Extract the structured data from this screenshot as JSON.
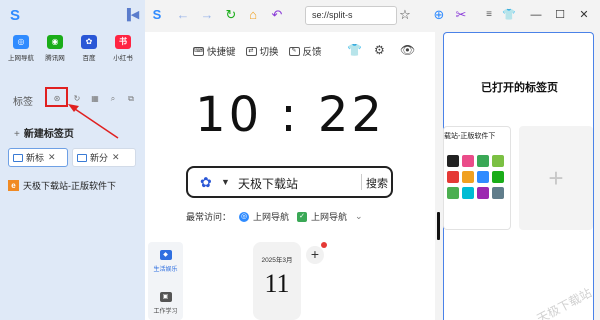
{
  "sidebar": {
    "quick_links": [
      {
        "label": "上网导航",
        "icon": "shield-nav-icon",
        "color": "#2f8bff",
        "glyph": "◎"
      },
      {
        "label": "腾讯网",
        "icon": "tencent-icon",
        "color": "#1aad19",
        "glyph": "◉"
      },
      {
        "label": "百度",
        "icon": "baidu-paw-icon",
        "color": "#2a57d6",
        "glyph": "✿"
      },
      {
        "label": "小红书",
        "icon": "xiaohongshu-icon",
        "color": "#ff2442",
        "glyph": "书"
      }
    ],
    "bookmarks_title": "标签",
    "new_tab_group": "新建标签页",
    "tabs": [
      {
        "label": "新标",
        "close": "✕"
      },
      {
        "label": "新分",
        "close": "✕"
      }
    ],
    "open_tab": {
      "favicon": "e",
      "label": "天极下载站-正版软件下"
    }
  },
  "toolbar": {
    "address": "se://split-s",
    "accent": "#2f8bff"
  },
  "main": {
    "links": [
      {
        "icon": "keyboard-icon",
        "label": "快捷键"
      },
      {
        "icon": "switch-icon",
        "label": "切换"
      },
      {
        "icon": "feedback-icon",
        "label": "反馈"
      }
    ],
    "clock": "10 : 22",
    "search": {
      "engine_text": "天极下载站",
      "button": "搜索"
    },
    "frequent": {
      "label": "最常访问：",
      "items": [
        "上网导航",
        "上网导航"
      ]
    },
    "categories": [
      {
        "label": "生活娱乐",
        "color": "#2f6fe0"
      },
      {
        "label": "工作学习",
        "color": "#555555"
      }
    ],
    "calendar": {
      "date": "2025年3月",
      "day": "11"
    }
  },
  "split_panel": {
    "title": "已打开的标签页",
    "card_title": "载站-正版软件下",
    "new_card_glyph": "+"
  },
  "watermark": "天极下载站"
}
